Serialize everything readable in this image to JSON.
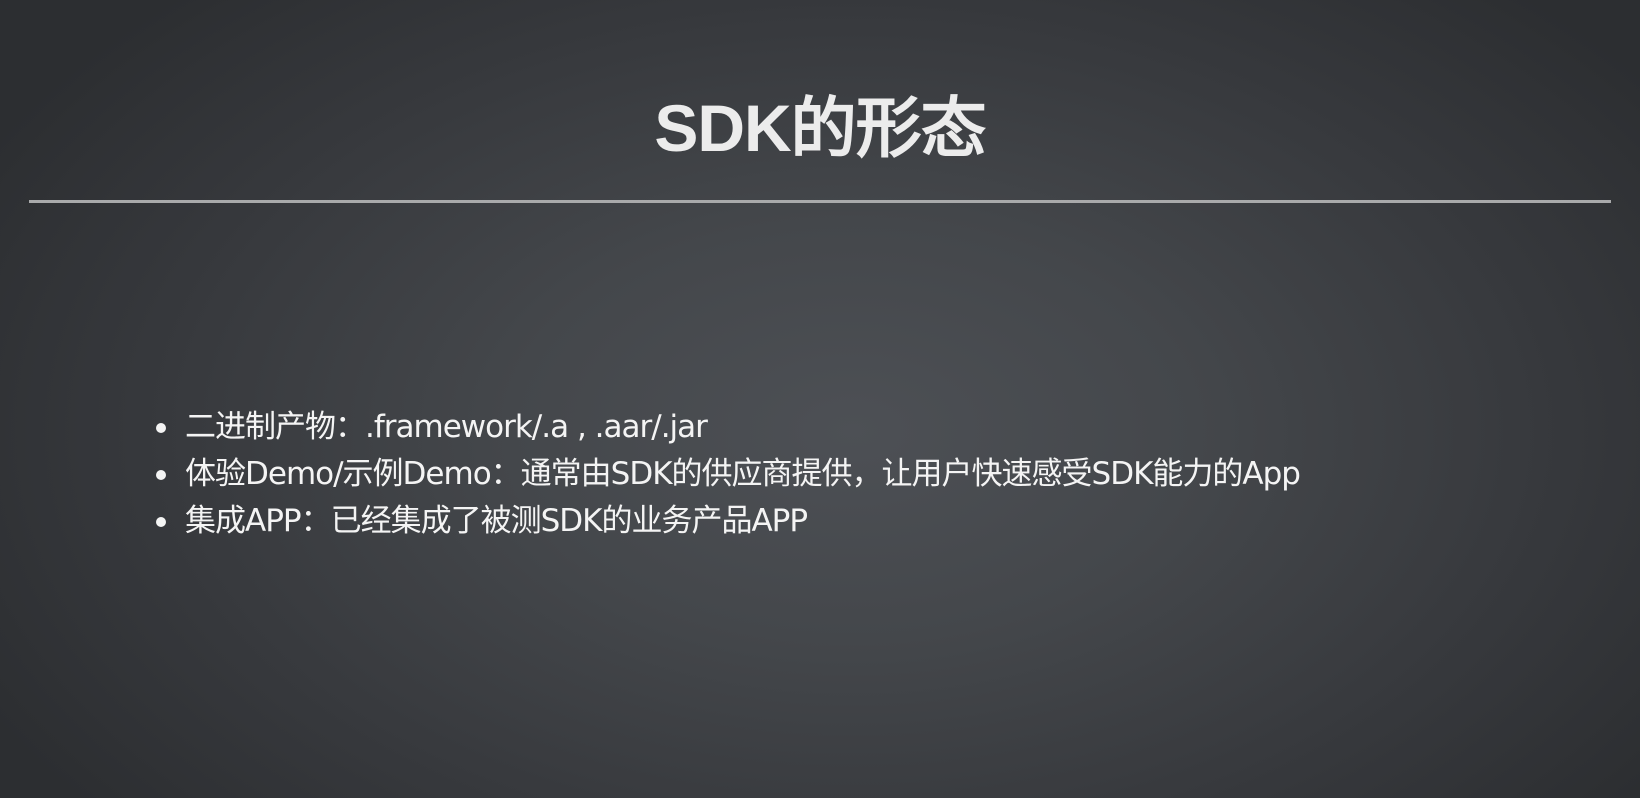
{
  "slide": {
    "title": "SDK的形态",
    "bullets": [
      "二进制产物：.framework/.a , .aar/.jar",
      "体验Demo/示例Demo：通常由SDK的供应商提供，让用户快速感受SDK能力的App",
      "集成APP：已经集成了被测SDK的业务产品APP"
    ]
  },
  "colors": {
    "background_center": "#4d5055",
    "background_edge": "#2c2e31",
    "text": "#f4f4f4",
    "rule": "#a9aaab"
  }
}
